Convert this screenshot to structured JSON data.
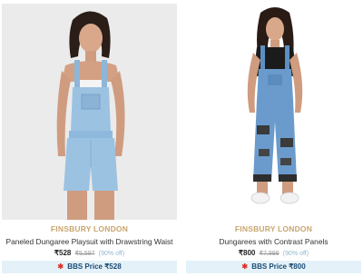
{
  "products": [
    {
      "brand": "FINSBURY LONDON",
      "title": "Paneled Dungaree Playsuit with Drawstring Waist",
      "price": "₹528",
      "mrp": "₹5,597",
      "discount": "(90% off)",
      "bbs_label": "BBS Price ₹528",
      "bbs_icon": "tag-icon",
      "image_bg": "#ebebeb"
    },
    {
      "brand": "FINSBURY LONDON",
      "title": "Dungarees with Contrast Panels",
      "price": "₹800",
      "mrp": "₹7,999",
      "discount": "(90% off)",
      "bbs_label": "BBS Price ₹800",
      "bbs_icon": "tag-icon",
      "image_bg": "#ffffff"
    }
  ],
  "colors": {
    "brand": "#c9a56e",
    "discount": "#8fb8d1",
    "bbs_bg": "#e4f1f8",
    "bbs_text": "#1a4b73",
    "bbs_icon": "#d9342b"
  }
}
